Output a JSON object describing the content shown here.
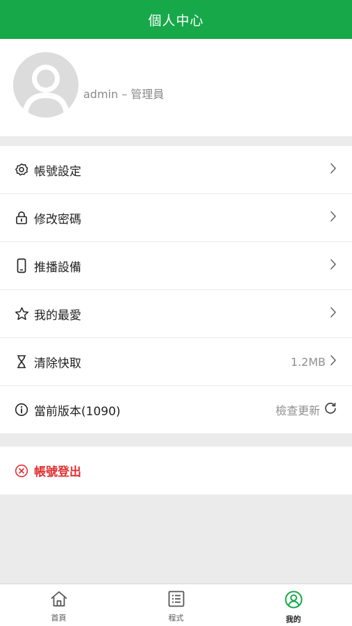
{
  "header": {
    "title": "個人中心",
    "color": "#17a84a"
  },
  "profile": {
    "name": "admin – 管理員"
  },
  "menu": {
    "items": [
      {
        "label": "帳號設定",
        "icon": "gear-icon",
        "value": "",
        "action_icon": "chevron-right-icon"
      },
      {
        "label": "修改密碼",
        "icon": "lock-icon",
        "value": "",
        "action_icon": "chevron-right-icon"
      },
      {
        "label": "推播設備",
        "icon": "phone-icon",
        "value": "",
        "action_icon": "chevron-right-icon"
      },
      {
        "label": "我的最愛",
        "icon": "star-icon",
        "value": "",
        "action_icon": "chevron-right-icon"
      },
      {
        "label": "清除快取",
        "icon": "hourglass-icon",
        "value": "1.2MB",
        "action_icon": "chevron-right-icon"
      },
      {
        "label": "當前版本(1090)",
        "icon": "info-icon",
        "value": "檢查更新",
        "action_icon": "refresh-icon"
      }
    ]
  },
  "logout": {
    "label": "帳號登出",
    "icon": "close-circle-icon",
    "color": "#e03030"
  },
  "tabbar": {
    "tabs": [
      {
        "label": "首頁",
        "icon": "home-icon",
        "active": false
      },
      {
        "label": "程式",
        "icon": "list-icon",
        "active": false
      },
      {
        "label": "我的",
        "icon": "user-circle-icon",
        "active": true
      }
    ],
    "active_color": "#17a84a"
  }
}
